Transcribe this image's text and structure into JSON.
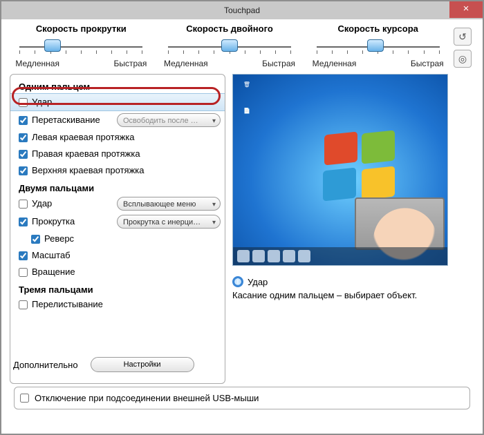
{
  "title": "Touchpad",
  "sliders": [
    {
      "label": "Скорость прокрутки",
      "min": "Медленная",
      "max": "Быстрая",
      "pos": 28
    },
    {
      "label": "Скорость двойного",
      "min": "Медленная",
      "max": "Быстрая",
      "pos": 50
    },
    {
      "label": "Скорость курсора",
      "min": "Медленная",
      "max": "Быстрая",
      "pos": 48
    }
  ],
  "onefinger": {
    "title": "Одним пальцем",
    "tap": {
      "label": "Удар",
      "checked": false
    },
    "drag": {
      "label": "Перетаскивание",
      "checked": true,
      "dd": "Освободить после …"
    },
    "left": {
      "label": "Левая краевая протяжка",
      "checked": true
    },
    "right": {
      "label": "Правая краевая протяжка",
      "checked": true
    },
    "top": {
      "label": "Верхняя краевая протяжка",
      "checked": true
    }
  },
  "twofinger": {
    "title": "Двумя пальцами",
    "tap": {
      "label": "Удар",
      "checked": false,
      "dd": "Всплывающее меню"
    },
    "scroll": {
      "label": "Прокрутка",
      "checked": true,
      "dd": "Прокрутка с инерци…"
    },
    "reverse": {
      "label": "Реверс",
      "checked": true
    },
    "zoom": {
      "label": "Масштаб",
      "checked": true
    },
    "rotate": {
      "label": "Вращение",
      "checked": false
    }
  },
  "threefinger": {
    "title": "Тремя пальцами",
    "flick": {
      "label": "Перелистывание",
      "checked": false
    }
  },
  "advanced": {
    "label": "Дополнительно",
    "button": "Настройки"
  },
  "disable": {
    "label": "Отключение при подсоединении внешней USB-мыши",
    "checked": false
  },
  "info": {
    "title": "Удар",
    "text": "Касание одним пальцем – выбирает объект."
  }
}
